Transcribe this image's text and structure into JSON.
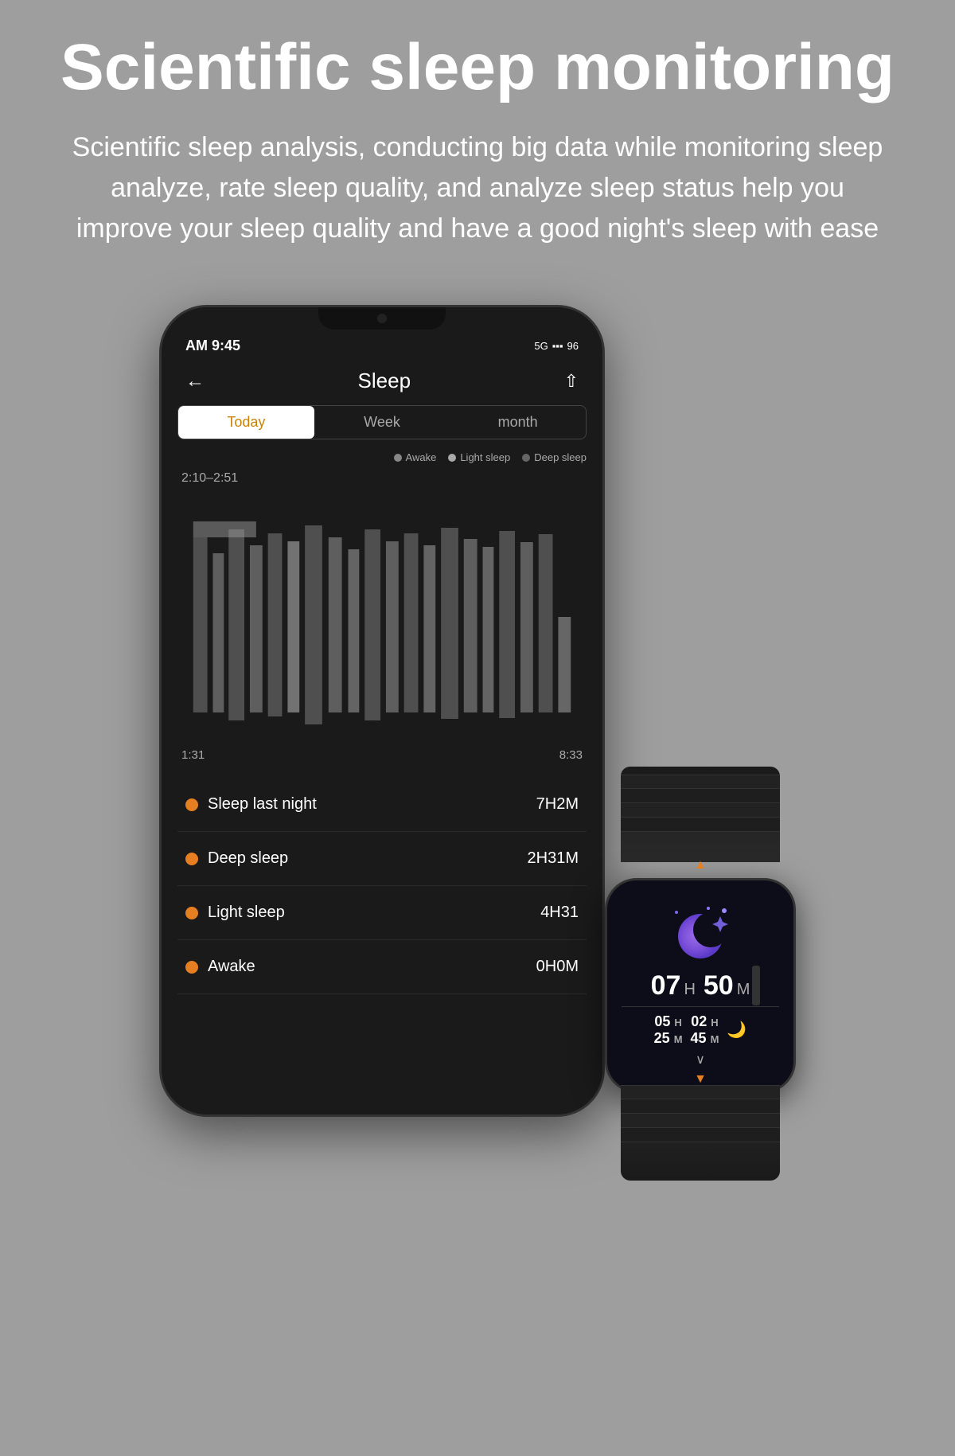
{
  "page": {
    "background_color": "#9e9e9e"
  },
  "header": {
    "main_title": "Scientific sleep monitoring",
    "sub_title": "Scientific sleep analysis, conducting big data while monitoring sleep analyze, rate sleep quality, and analyze sleep status help you improve your sleep quality and have a good night's sleep with ease"
  },
  "phone": {
    "status_bar": {
      "time": "AM 9:45",
      "network": "5G",
      "battery": "96"
    },
    "app_title": "Sleep",
    "tabs": [
      {
        "label": "Today",
        "active": true
      },
      {
        "label": "Week",
        "active": false
      },
      {
        "label": "month",
        "active": false
      }
    ],
    "legend": [
      {
        "label": "Awake",
        "color": "#888"
      },
      {
        "label": "Light sleep",
        "color": "#aaa"
      },
      {
        "label": "Deep sleep",
        "color": "#666"
      }
    ],
    "chart": {
      "time_label": "2:10–2:51",
      "axis_start": "1:31",
      "axis_end": "8:33"
    },
    "stats": [
      {
        "label": "Sleep last night",
        "value": "7H2M"
      },
      {
        "label": "Deep sleep",
        "value": "2H31M"
      },
      {
        "label": "Light sleep",
        "value": "4H31"
      },
      {
        "label": "Awake",
        "value": "0H0M"
      }
    ]
  },
  "watch": {
    "time_hours": "07",
    "time_hours_unit": "H",
    "time_minutes": "50",
    "time_minutes_unit": "M",
    "sub_times": [
      {
        "number": "05",
        "unit": "H"
      },
      {
        "number": "25",
        "unit": "M"
      },
      {
        "number": "02",
        "unit": "H"
      },
      {
        "number": "45",
        "unit": "M"
      }
    ]
  },
  "icons": {
    "back_arrow": "←",
    "share": "⎋",
    "chevron_down": "∨"
  }
}
